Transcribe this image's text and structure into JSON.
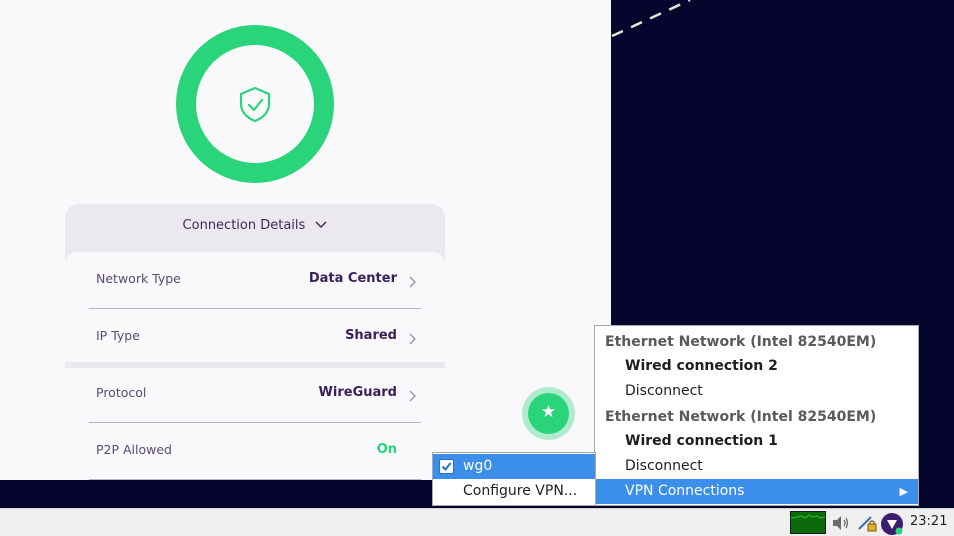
{
  "app": {
    "connection_details_label": "Connection Details",
    "details": [
      {
        "label": "Network Type",
        "value": "Data Center"
      },
      {
        "label": "IP Type",
        "value": "Shared"
      },
      {
        "label": "Protocol",
        "value": "WireGuard"
      },
      {
        "label": "P2P Allowed",
        "value": "On"
      }
    ],
    "status_color": "#2ad47a"
  },
  "network_menu": {
    "sections": [
      {
        "header": "Ethernet Network (Intel 82540EM)",
        "connection": "Wired connection 2",
        "action": "Disconnect"
      },
      {
        "header": "Ethernet Network (Intel 82540EM)",
        "connection": "Wired connection 1",
        "action": "Disconnect"
      }
    ],
    "vpn_connections_label": "VPN Connections"
  },
  "vpn_submenu": {
    "items": [
      {
        "label": "wg0",
        "checked": true
      },
      {
        "label": "Configure VPN..."
      }
    ]
  },
  "taskbar": {
    "clock": "23:21"
  }
}
